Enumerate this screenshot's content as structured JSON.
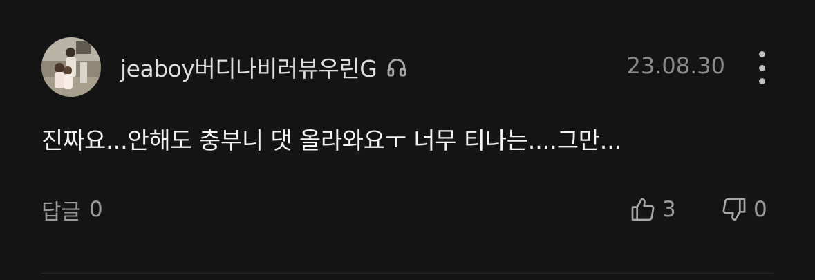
{
  "comment": {
    "author": "jeaboy버디나비러뷰우린G",
    "author_badge_icon": "headphones-icon",
    "date": "23.08.30",
    "menu_icon": "more-vertical-icon",
    "text": "진짜요...안해도 충부니 댓 올라와요ㅜ 너무 티나는....그만...",
    "reply": {
      "label": "답글",
      "count": "0"
    },
    "likes": {
      "icon": "thumbs-up-icon",
      "count": "3"
    },
    "dislikes": {
      "icon": "thumbs-down-icon",
      "count": "0"
    }
  },
  "colors": {
    "background": "#141414",
    "text_primary": "#f4f4f4",
    "text_secondary": "#9a9a9a",
    "divider": "#2c2c2c"
  }
}
